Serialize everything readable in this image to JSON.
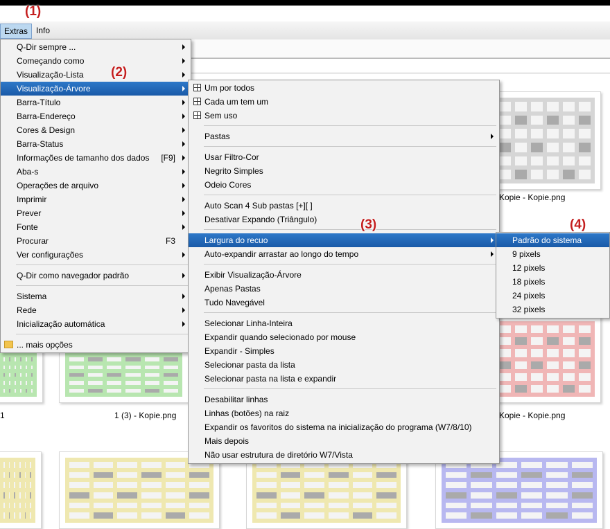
{
  "callouts": {
    "c1": "(1)",
    "c2": "(2)",
    "c3": "(3)",
    "c4": "(4)"
  },
  "menubar": {
    "extras": "Extras",
    "info": "Info"
  },
  "thumbnails": {
    "label_right_top": "Kopie - Kopie.png",
    "label_mid_bottom": "1 (3) - Kopie.png",
    "label_right_bottom": "Kopie - Kopie.png",
    "label_left_bottom": "1",
    "colors": {
      "gray": "#d6d6d6",
      "green": "#b8e6b0",
      "red": "#f0b6b6",
      "yellow": "#efe8b0",
      "blue": "#b8b8f0"
    }
  },
  "extras_menu": {
    "items": [
      "Q-Dir sempre ...",
      "Começando como",
      "Visualização-Lista",
      "Visualização-Árvore",
      "Barra-Título",
      "Barra-Endereço",
      "Cores & Design",
      "Barra-Status",
      "Informações de tamanho dos dados",
      "Aba-s",
      "Operações de arquivo",
      "Imprimir",
      "Prever",
      "Fonte",
      "Procurar",
      "Ver configurações",
      "Q-Dir como navegador padrão",
      "Sistema",
      "Rede",
      "Inicialização automática",
      "... mais opções"
    ],
    "shortcuts": {
      "info_size": "[F9]",
      "search": "F3"
    }
  },
  "tree_menu": {
    "items": [
      "Um por todos",
      "Cada um tem um",
      "Sem uso",
      "Pastas",
      "Usar Filtro-Cor",
      "Negrito Simples",
      "Odeio Cores",
      "Auto Scan 4 Sub pastas [+][ ]",
      "Desativar Expando (Triângulo)",
      "Largura do recuo",
      "Auto-expandir arrastar ao longo do tempo",
      "Exibir Visualização-Árvore",
      "Apenas Pastas",
      "Tudo Navegável",
      "Selecionar Linha-Inteira",
      "Expandir quando selecionado por mouse",
      "Expandir - Simples",
      "Selecionar pasta da lista",
      "Selecionar pasta na lista e expandir",
      "Desabilitar linhas",
      "Linhas (botões) na raiz",
      "Expandir os favoritos do sistema na inicialização do programa (W7/8/10)",
      "Mais depois",
      "Não usar estrutura de diretório W7/Vista"
    ]
  },
  "indent_menu": {
    "items": [
      "Padrão do sistema",
      "9 pixels",
      "12 pixels",
      "18 pixels",
      "24 pixels",
      "32 pixels"
    ]
  }
}
